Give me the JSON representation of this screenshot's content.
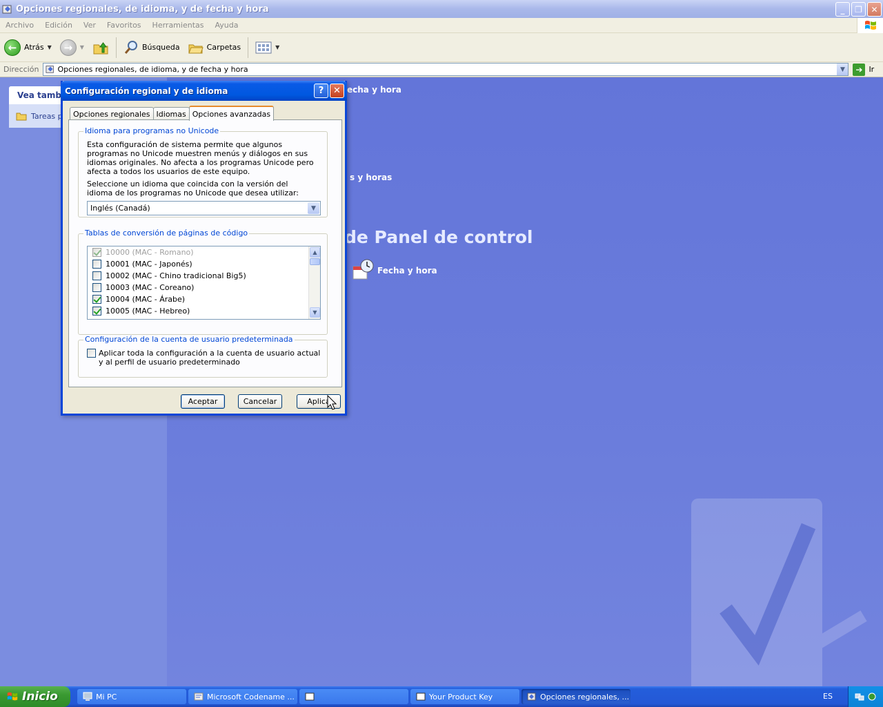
{
  "window": {
    "title": "Opciones regionales, de idioma, y de fecha y hora",
    "minimize": "_",
    "restore": "❐",
    "close": "✕"
  },
  "menu": [
    "Archivo",
    "Edición",
    "Ver",
    "Favoritos",
    "Herramientas",
    "Ayuda"
  ],
  "toolbar": {
    "back": "Atrás",
    "search": "Búsqueda",
    "folders": "Carpetas"
  },
  "address": {
    "label": "Dirección",
    "value": "Opciones regionales, de idioma, y de fecha y hora",
    "go": "Ir"
  },
  "left_pane": {
    "see_also": "Vea también",
    "tasks_link": "Tareas p"
  },
  "right_pane": {
    "partial_heading_1": "echa y hora",
    "partial_heading_2": "s y horas",
    "panel_title": "de Panel de control",
    "icon_label": "Fecha y hora"
  },
  "dialog": {
    "title": "Configuración regional y de idioma",
    "help": "?",
    "close": "✕",
    "tabs": [
      "Opciones regionales",
      "Idiomas",
      "Opciones avanzadas"
    ],
    "active_tab": 2,
    "group1": {
      "legend": "Idioma para programas no Unicode",
      "text1": "Esta configuración de sistema permite que algunos programas no Unicode muestren menús y diálogos en sus idiomas originales. No afecta a los programas Unicode pero afecta a todos los usuarios de este equipo.",
      "text2": "Seleccione un idioma que coincida con la versión del idioma de los programas no Unicode que desea utilizar:",
      "selected": "Inglés (Canadá)"
    },
    "group2": {
      "legend": "Tablas de conversión de páginas de código",
      "items": [
        {
          "label": "10000 (MAC - Romano)",
          "checked": true,
          "disabled": true
        },
        {
          "label": "10001 (MAC - Japonés)",
          "checked": false,
          "disabled": false
        },
        {
          "label": "10002 (MAC - Chino tradicional Big5)",
          "checked": false,
          "disabled": false
        },
        {
          "label": "10003 (MAC - Coreano)",
          "checked": false,
          "disabled": false
        },
        {
          "label": "10004 (MAC - Árabe)",
          "checked": true,
          "disabled": false
        },
        {
          "label": "10005 (MAC - Hebreo)",
          "checked": true,
          "disabled": false
        }
      ]
    },
    "group3": {
      "legend": "Configuración de la cuenta de usuario predeterminada",
      "checkbox_label": "Aplicar toda la configuración a la cuenta de usuario actual y al perfil de usuario predeterminado",
      "checked": false
    },
    "buttons": {
      "ok": "Aceptar",
      "cancel": "Cancelar",
      "apply": "Aplica"
    }
  },
  "taskbar": {
    "start": "Inicio",
    "tasks": [
      "Mi PC",
      "Microsoft Codename ...",
      "",
      "Your Product Key",
      "Opciones regionales, ..."
    ],
    "active_task": 4,
    "language": "ES"
  },
  "colors": {
    "desktop_blue": "#6375d9",
    "dialog_title_blue": "#0058e0",
    "legend_blue": "#0046d5",
    "start_green": "#3a9a32"
  }
}
